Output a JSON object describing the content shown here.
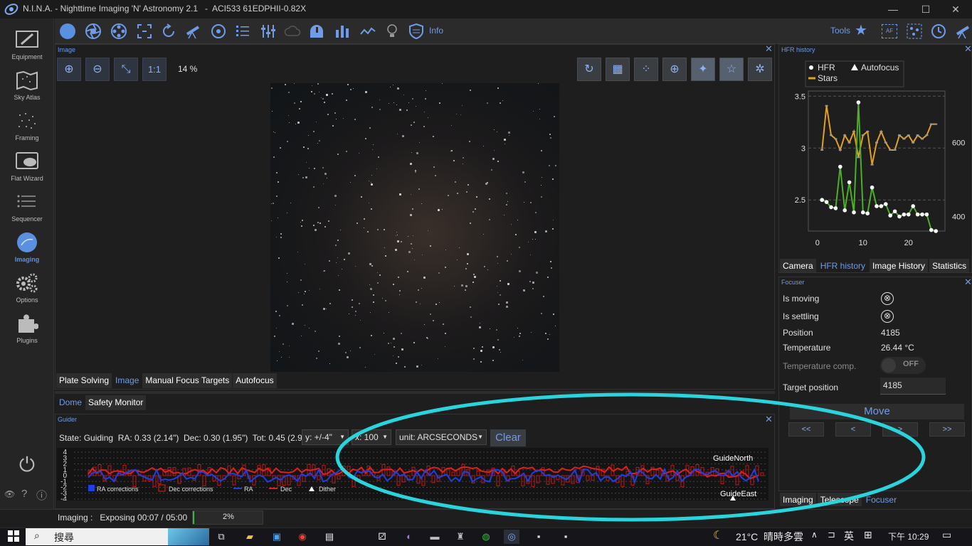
{
  "window": {
    "app_name": "N.I.N.A. - Nighttime Imaging 'N' Astronomy 2.1   -  ACI533 61EDPHII-0.82X",
    "minimize": "—",
    "maximize": "☐",
    "close": "✕"
  },
  "nav": {
    "items": [
      {
        "label": "Equipment",
        "icon": "telescope-camera-icon"
      },
      {
        "label": "Sky Atlas",
        "icon": "map-icon"
      },
      {
        "label": "Framing",
        "icon": "stars-icon"
      },
      {
        "label": "Flat Wizard",
        "icon": "flat-panel-icon"
      },
      {
        "label": "Sequencer",
        "icon": "list-icon"
      },
      {
        "label": "Imaging",
        "icon": "imaging-icon"
      },
      {
        "label": "Options",
        "icon": "gears-icon"
      },
      {
        "label": "Plugins",
        "icon": "puzzle-icon"
      }
    ],
    "active": "Imaging",
    "power": "⏻",
    "eye": "👁",
    "help": "?",
    "info": "ⓘ",
    "collapse": "<<"
  },
  "toolbar": {
    "info_label": "Info",
    "tools_label": "Tools",
    "af_label": "AF"
  },
  "image_panel": {
    "title": "Image",
    "close": "✕",
    "zoom_in": "⊕",
    "zoom_out": "⊖",
    "fit": "⤡",
    "one_to_one": "1:1",
    "zoom_level": "14 %",
    "tabs": [
      "Plate Solving",
      "Image",
      "Manual Focus Targets",
      "Autofocus"
    ],
    "active_tab": "Image"
  },
  "dome_tabs": {
    "tabs": [
      "Dome",
      "Safety Monitor"
    ],
    "active_tab": "Dome"
  },
  "guider": {
    "title": "Guider",
    "close": "✕",
    "state_text": "State: Guiding  RA: 0.33 (2.14\")  Dec: 0.30 (1.95\")  Tot: 0.45 (2.90\")",
    "y_select": "y: +/-4\"",
    "x_select": "x: 100",
    "unit_select": "unit: ARCSECONDS",
    "clear_label": "Clear",
    "y_ticks": [
      "4",
      "3",
      "2",
      "1",
      "0",
      "-1",
      "-2",
      "-3",
      "-4"
    ],
    "legend": [
      "RA corrections",
      "Dec corrections",
      "RA",
      "Dec",
      "Dither"
    ],
    "label_north": "GuideNorth",
    "label_east": "GuideEast",
    "colors": {
      "ra": "#1f3fe0",
      "dec": "#e01f1f"
    }
  },
  "hfr_panel": {
    "title": "HFR history",
    "close": "✕",
    "legend": [
      "HFR",
      "Autofocus",
      "Stars"
    ],
    "tabs": [
      "Camera",
      "HFR history",
      "Image History",
      "Statistics"
    ],
    "active_tab": "HFR history"
  },
  "chart_data": {
    "type": "line",
    "x_ticks": [
      "0",
      "10",
      "20"
    ],
    "y_left_ticks": [
      "3.5",
      "3",
      "2.5"
    ],
    "y_right_ticks": [
      "600",
      "400"
    ],
    "xlim": [
      -2,
      28
    ],
    "ylim_left": [
      2.2,
      3.55
    ],
    "ylim_right": [
      360,
      740
    ],
    "grid": true,
    "legend_position": "top-left",
    "series": [
      {
        "name": "HFR",
        "axis": "left",
        "color": "#4caf25",
        "marker": "#ffffff",
        "x": [
          1,
          2,
          3,
          4,
          5,
          6,
          7,
          8,
          9,
          10,
          11,
          12,
          13,
          14,
          15,
          16,
          17,
          18,
          19,
          20,
          21,
          22,
          23,
          24,
          25,
          26
        ],
        "y": [
          2.5,
          2.48,
          2.43,
          2.42,
          2.82,
          2.4,
          2.67,
          2.38,
          3.44,
          2.38,
          2.37,
          2.62,
          2.44,
          2.44,
          2.46,
          2.35,
          2.39,
          2.34,
          2.36,
          2.36,
          2.44,
          2.36,
          2.36,
          2.36,
          2.21,
          2.2
        ]
      },
      {
        "name": "Stars",
        "axis": "right",
        "color": "#e0a020",
        "x": [
          1,
          2,
          3,
          4,
          5,
          6,
          7,
          8,
          9,
          10,
          11,
          12,
          13,
          14,
          15,
          16,
          17,
          18,
          19,
          20,
          21,
          22,
          23,
          24,
          25,
          26
        ],
        "y": [
          580,
          700,
          620,
          610,
          580,
          620,
          600,
          630,
          560,
          620,
          630,
          540,
          600,
          630,
          600,
          580,
          580,
          620,
          610,
          620,
          600,
          620,
          610,
          620,
          650,
          650
        ]
      }
    ]
  },
  "focuser": {
    "title": "Focuser",
    "close": "✕",
    "rows": [
      {
        "label": "Is moving",
        "value": "⊗"
      },
      {
        "label": "Is settling",
        "value": "⊗"
      },
      {
        "label": "Position",
        "value": "4185"
      },
      {
        "label": "Temperature",
        "value": "26.44 °C"
      },
      {
        "label": "Temperature comp.",
        "value": "OFF"
      },
      {
        "label": "Target position",
        "value": "4185"
      }
    ],
    "move_label": "Move",
    "steps": [
      "<<",
      "<",
      ">",
      ">>"
    ],
    "tabs": [
      "Imaging",
      "Telescope",
      "Focuser"
    ],
    "active_tab": "Focuser"
  },
  "status_bar": {
    "status_text": "Imaging :   Exposing 00:07 / 05:00",
    "progress_percent": 2,
    "progress_label": "2%"
  },
  "taskbar": {
    "search_placeholder": "搜尋",
    "weather": "21°C  晴時多雲",
    "ime": "英",
    "time": "下午 10:29"
  }
}
